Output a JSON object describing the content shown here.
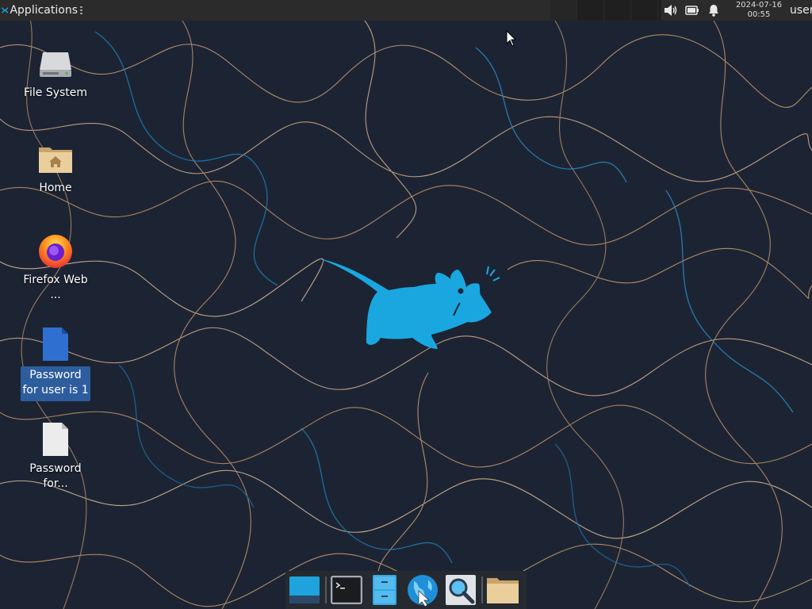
{
  "top_panel": {
    "applications_label": "Applications",
    "clock_date": "2024-07-16",
    "clock_time": "00:55",
    "user_label": "user",
    "icons": {
      "app_logo": "xfce-logo-icon",
      "volume": "speaker-icon",
      "battery": "battery-icon",
      "notifications": "bell-icon"
    },
    "workspace_count": 4
  },
  "desktop_icons": [
    {
      "label": "File System",
      "icon": "drive-icon"
    },
    {
      "label": "Home",
      "icon": "home-folder-icon"
    },
    {
      "label": "Firefox Web ...",
      "icon": "firefox-icon"
    },
    {
      "label": "Password for user is 1",
      "icon": "blue-document-icon",
      "selected": true
    },
    {
      "label": "Password for...",
      "icon": "text-document-icon"
    }
  ],
  "dock": {
    "items": [
      {
        "name": "show-desktop",
        "icon": "desktop-icon"
      },
      {
        "name": "terminal",
        "icon": "terminal-icon"
      },
      {
        "name": "file-manager",
        "icon": "file-cabinet-icon"
      },
      {
        "name": "web-browser",
        "icon": "globe-icon"
      },
      {
        "name": "app-finder",
        "icon": "magnifier-icon"
      },
      {
        "name": "home-folder",
        "icon": "folder-icon"
      }
    ]
  },
  "colors": {
    "accent": "#1aa7e0",
    "panel": "#2b2b2b",
    "background": "#1c2434",
    "selection": "#2e5d9e"
  }
}
